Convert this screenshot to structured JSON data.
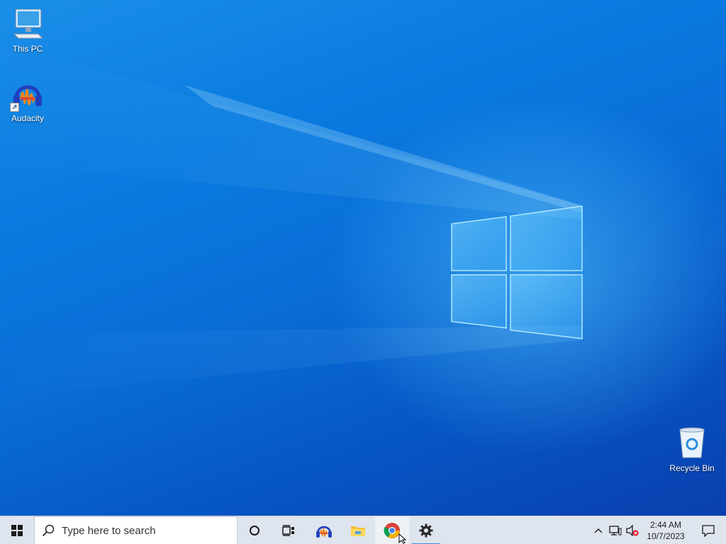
{
  "desktop": {
    "icons": [
      {
        "label": "This PC",
        "icon": "computer-icon"
      },
      {
        "label": "Audacity",
        "icon": "audacity-icon"
      },
      {
        "label": "Recycle Bin",
        "icon": "recycle-bin-icon"
      }
    ],
    "wallpaper": "windows-10-hero",
    "accent_color": "#0a6fd8"
  },
  "taskbar": {
    "start_icon": "windows-logo-icon",
    "search": {
      "placeholder": "Type here to search",
      "icon": "search-icon"
    },
    "buttons": [
      {
        "name": "cortana",
        "icon": "cortana-circle-icon"
      },
      {
        "name": "task-view",
        "icon": "task-view-icon"
      },
      {
        "name": "audacity",
        "icon": "audacity-icon"
      },
      {
        "name": "file-explorer",
        "icon": "folder-icon"
      },
      {
        "name": "chrome",
        "icon": "chrome-icon"
      },
      {
        "name": "settings",
        "icon": "gear-icon",
        "active": true
      }
    ],
    "tray": {
      "icons": [
        "chevron-up-icon",
        "network-icon",
        "volume-muted-icon"
      ],
      "time": "2:44 AM",
      "date": "10/7/2023",
      "notification_icon": "action-center-icon"
    },
    "background": "#dfe5ee"
  }
}
